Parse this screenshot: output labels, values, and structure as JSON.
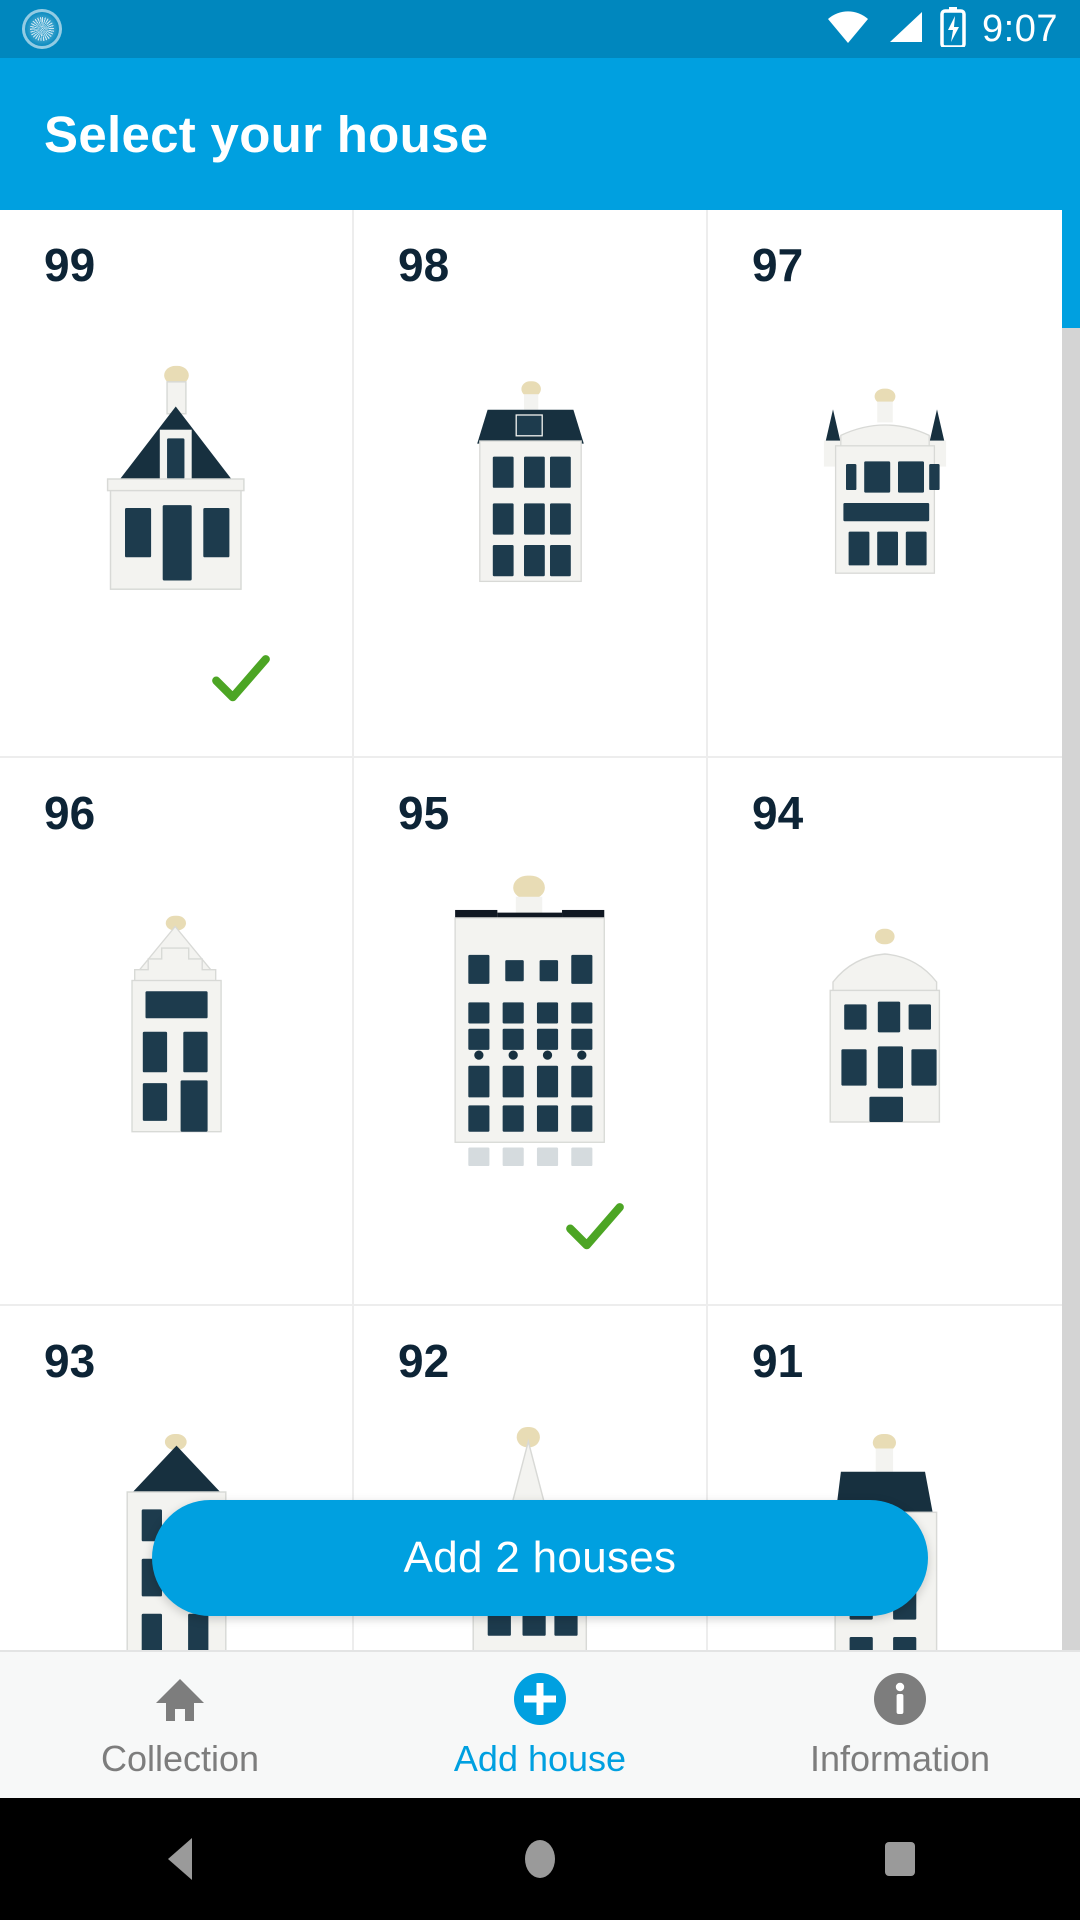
{
  "statusbar": {
    "time": "9:07",
    "icons": [
      "sync-icon",
      "wifi-icon",
      "cellular-signal-icon",
      "battery-charging-icon"
    ]
  },
  "appbar": {
    "title": "Select your house"
  },
  "grid": {
    "cells": [
      {
        "number": "99",
        "house_type": "gabled-townhouse",
        "selected": true
      },
      {
        "number": "98",
        "house_type": "tiled-roof-townhouse",
        "selected": false
      },
      {
        "number": "97",
        "house_type": "twin-tower-mansion",
        "selected": false
      },
      {
        "number": "96",
        "house_type": "stepped-gable-house",
        "selected": false
      },
      {
        "number": "95",
        "house_type": "grand-flat-roof-building",
        "selected": true
      },
      {
        "number": "94",
        "house_type": "ornate-gable-house",
        "selected": false
      },
      {
        "number": "93",
        "house_type": "narrow-canal-house",
        "selected": false
      },
      {
        "number": "92",
        "house_type": "spire-tower-house",
        "selected": false
      },
      {
        "number": "91",
        "house_type": "tall-canal-house",
        "selected": false
      }
    ]
  },
  "fab": {
    "label": "Add 2 houses"
  },
  "bottomnav": {
    "items": [
      {
        "label": "Collection",
        "icon": "home-icon",
        "active": false
      },
      {
        "label": "Add house",
        "icon": "plus-circle-icon",
        "active": true
      },
      {
        "label": "Information",
        "icon": "info-circle-icon",
        "active": false
      }
    ]
  },
  "androidnav": {
    "buttons": [
      "back-button",
      "home-button",
      "recents-button"
    ]
  },
  "colors": {
    "statusbar": "#0087BE",
    "accent": "#00A0E0",
    "check": "#4CA524",
    "number": "#0d2436",
    "nav_inactive": "#7d7d7d"
  }
}
